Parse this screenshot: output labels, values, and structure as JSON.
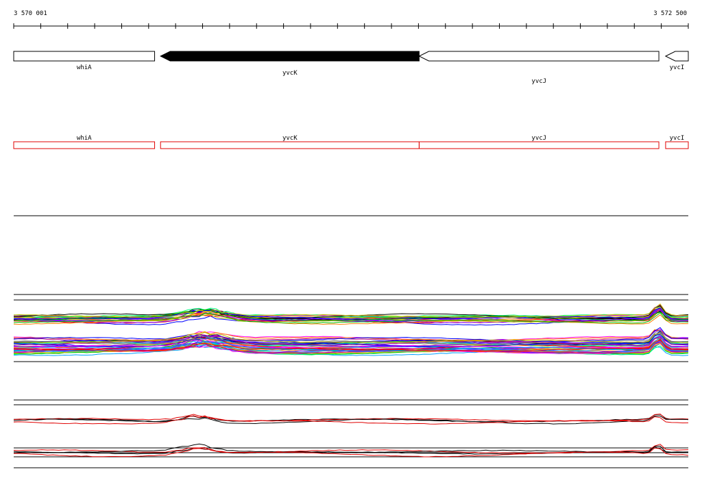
{
  "ruler": {
    "start_label": "3 570 001",
    "end_label": "3 572 500",
    "start_bp": 3570001,
    "end_bp": 3572500
  },
  "colors": {
    "feature_outline": "#000000",
    "highlighted_feature": "#000000",
    "transcript_outline": "#e00000",
    "track_line": "#000000",
    "line_palette": [
      "#ff0000",
      "#00c000",
      "#0000ff",
      "#ff00ff",
      "#00c0c0",
      "#c0c000",
      "#ff8000",
      "#8000ff",
      "#00ff80",
      "#808080",
      "#000000",
      "#ffc000",
      "#c00080",
      "#00a0ff"
    ]
  },
  "genes": [
    {
      "name": "whiA",
      "start": 3570001,
      "end": 3570523,
      "strand": "+",
      "filled": false,
      "label_row": 0
    },
    {
      "name": "yvcK",
      "start": 3570545,
      "end": 3571503,
      "strand": "-",
      "filled": true,
      "label_row": 1
    },
    {
      "name": "yvcJ",
      "start": 3571503,
      "end": 3572391,
      "strand": "-",
      "filled": false,
      "label_row": 2
    },
    {
      "name": "yvcI",
      "start": 3572416,
      "end": 3572500,
      "strand": "-",
      "filled": false,
      "label_row": 0
    }
  ],
  "transcripts": [
    {
      "name": "whiA",
      "start": 3570001,
      "end": 3570523
    },
    {
      "name": "yvcK",
      "start": 3570545,
      "end": 3571503
    },
    {
      "name": "yvcJ",
      "start": 3571503,
      "end": 3572391
    },
    {
      "name": "yvcI",
      "start": 3572416,
      "end": 3572500
    }
  ],
  "chart_data": {
    "type": "line",
    "x_range": [
      3570001,
      3572500
    ],
    "tracks": [
      {
        "name": "",
        "bands": [
          {
            "series_count": 22,
            "baseline": 0.64,
            "spread": 0.1,
            "palette": "multi"
          },
          {
            "series_count": 40,
            "baseline": 0.25,
            "spread": 0.22,
            "palette": "multi"
          }
        ],
        "bumps": [
          {
            "x": 3570580,
            "width": 260,
            "height": 0.12
          },
          {
            "x": 3572360,
            "width": 60,
            "height": 0.18
          }
        ]
      },
      {
        "name": "",
        "bands": [
          {
            "series_count": 4,
            "baseline": 0.7,
            "spread": 0.05,
            "palette": "black-red"
          },
          {
            "series_count": 4,
            "baseline": 0.22,
            "spread": 0.05,
            "palette": "black-red"
          }
        ],
        "bumps": [
          {
            "x": 3570580,
            "width": 200,
            "height": 0.1
          },
          {
            "x": 3572360,
            "width": 50,
            "height": 0.12
          }
        ]
      }
    ]
  }
}
